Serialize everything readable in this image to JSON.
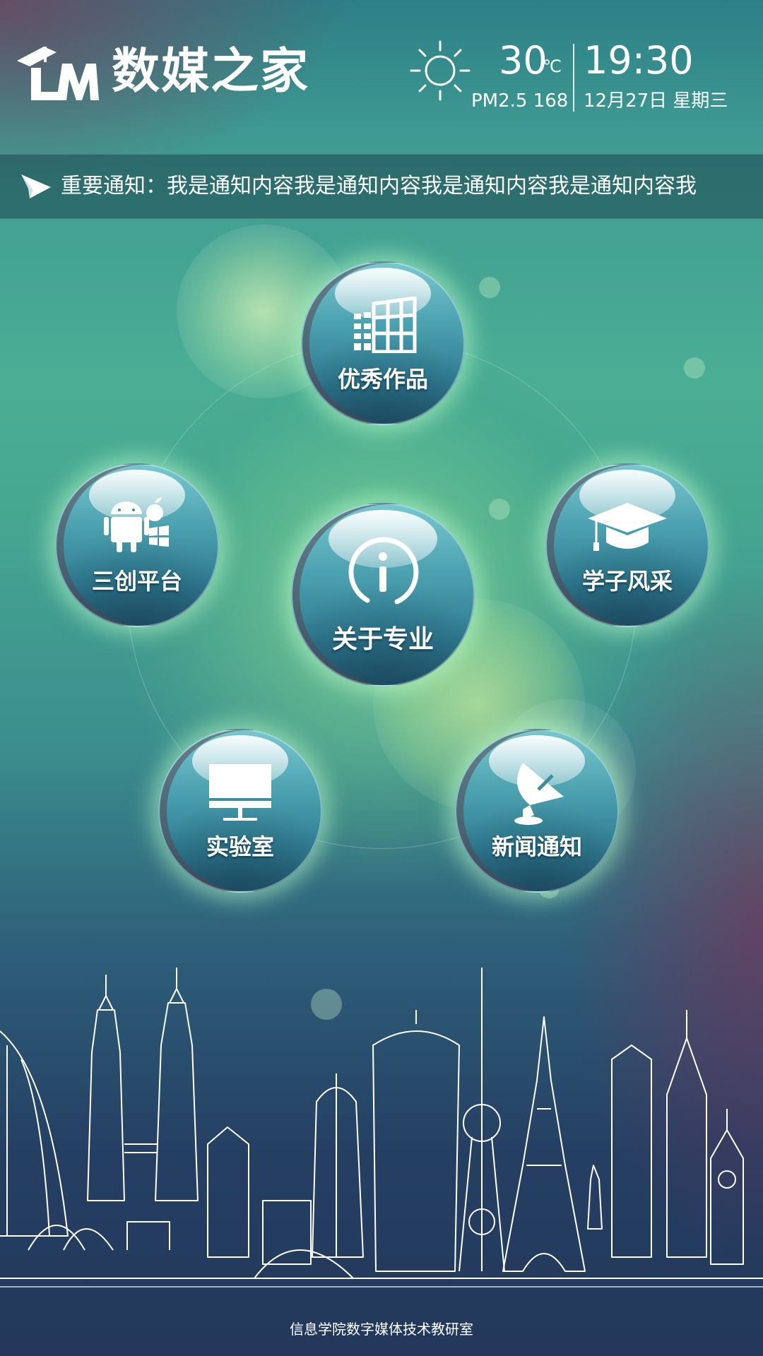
{
  "header": {
    "app_title": "数媒之家",
    "logo_mark": "LM",
    "weather_icon": "sun-icon",
    "temperature": "30",
    "temperature_unit": "℃",
    "pm25": "PM2.5 168",
    "time": "19:30",
    "date": "12月27日   星期三"
  },
  "notice": {
    "icon": "paper-plane-icon",
    "text": "重要通知：我是通知内容我是通知内容我是通知内容我是通知内容我"
  },
  "menu": {
    "top": {
      "label": "优秀作品",
      "icon": "building-icon"
    },
    "left": {
      "label": "三创平台",
      "icon": "platforms-icon"
    },
    "center": {
      "label": "关于专业",
      "icon": "info-icon"
    },
    "right": {
      "label": "学子风采",
      "icon": "graduation-cap-icon"
    },
    "bottom_left": {
      "label": "实验室",
      "icon": "monitor-icon"
    },
    "bottom_right": {
      "label": "新闻通知",
      "icon": "satellite-dish-icon"
    }
  },
  "footer": {
    "text": "信息学院数字媒体技术教研室"
  },
  "colors": {
    "accent_glow": "#bfffc8",
    "bubble_top": "#78c7cf",
    "bubble_bottom": "#255a72"
  }
}
